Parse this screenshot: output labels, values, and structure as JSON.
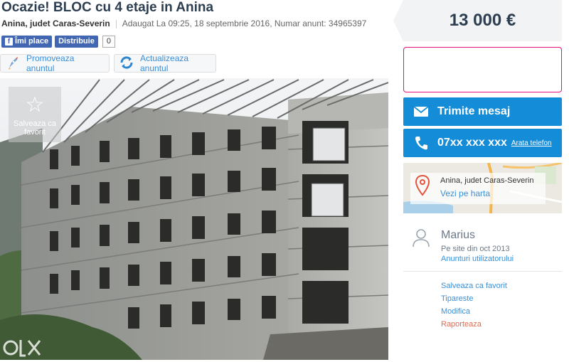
{
  "ad": {
    "title": "Ocazie! BLOC cu 4 etaje in Anina",
    "location": "Anina, judet Caras-Severin",
    "added": "Adaugat La 09:25, 18 septembrie 2016, Numar anunt: 34965397"
  },
  "social": {
    "like_label": "Îmi place",
    "share_label": "Distribuie",
    "count": "0"
  },
  "actions": {
    "promote_label": "Promoveaza anuntul",
    "refresh_label": "Actualizeaza anuntul"
  },
  "gallery": {
    "save_favorite_label": "Salveaza ca favorit"
  },
  "sidebar": {
    "price": "13 000 €",
    "send_message_label": "Trimite mesaj",
    "phone_number": "07xx xxx xxx",
    "show_phone_label": "Arata telefon",
    "map": {
      "location": "Anina, judet Caras-Severin",
      "view_map_label": "Vezi pe harta"
    },
    "seller": {
      "name": "Marius",
      "member_since": "Pe site din oct 2013",
      "user_ads_label": "Anunturi utilizatorului"
    },
    "links": {
      "save_favorite": "Salveaza ca favorit",
      "print": "Tipareste",
      "edit": "Modifica",
      "report": "Raporteaza"
    }
  },
  "branding": {
    "logo_text": "OLX"
  },
  "colors": {
    "accent_blue": "#158cd8",
    "link_blue": "#3a8fd7",
    "ad_border": "#e4117c",
    "report_orange": "#e36a4d"
  }
}
